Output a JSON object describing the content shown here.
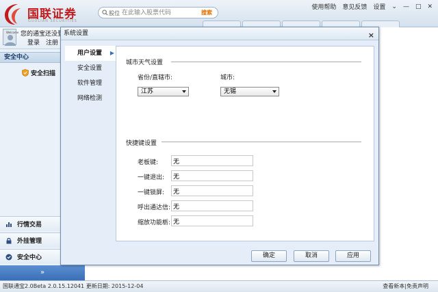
{
  "app": {
    "logo_text": "国联证券",
    "logo_sub": "GUOLIAN SECURITIES"
  },
  "search": {
    "tag": "股位",
    "placeholder": "在此输入股票代码",
    "button": "搜索"
  },
  "top_menu": [
    "使用帮助",
    "意见反馈",
    "设置"
  ],
  "window_controls": [
    "chevron-down-icon",
    "minimize-icon",
    "maximize-icon",
    "close-icon"
  ],
  "user": {
    "welcome": "Welcome",
    "greeting": "您的通宝还没登",
    "login": "登录",
    "register": "注册"
  },
  "sidebar": {
    "section": "安全中心",
    "scan_item": "安全扫描",
    "nav": [
      {
        "label": "行情交易",
        "icon": "chart-icon"
      },
      {
        "label": "外挂管理",
        "icon": "lock-icon"
      },
      {
        "label": "安全中心",
        "icon": "shield-check-icon"
      }
    ],
    "expand": "»"
  },
  "status": {
    "left": "国联通宝2.0Beta 2.0.15.12041 更新日期: 2015-12-04",
    "check_version": "查看新本",
    "separator": "|",
    "disclaimer": "免责声明"
  },
  "dialog": {
    "title": "系统设置",
    "close": "×",
    "nav": [
      {
        "label": "用户设置",
        "active": true,
        "arrow": "▶"
      },
      {
        "label": "安全设置",
        "active": false
      },
      {
        "label": "软件管理",
        "active": false
      },
      {
        "label": "网络检测",
        "active": false
      }
    ],
    "weather": {
      "title": "城市天气设置",
      "province_label": "省份/直辖市:",
      "province_value": "江苏",
      "city_label": "城市:",
      "city_value": "无锡"
    },
    "hotkeys": {
      "title": "快捷键设置",
      "items": [
        {
          "label": "老板键:",
          "value": "无"
        },
        {
          "label": "一键退出:",
          "value": "无"
        },
        {
          "label": "一键锁屏:",
          "value": "无"
        },
        {
          "label": "呼出通达信:",
          "value": "无"
        },
        {
          "label": "缩放功能栃:",
          "value": "无"
        }
      ]
    },
    "buttons": {
      "ok": "确定",
      "cancel": "取消",
      "apply": "应用"
    }
  },
  "colors": {
    "brand": "#c31b1b",
    "accent_blue": "#3b6fb6",
    "search_button": "#e07000"
  }
}
